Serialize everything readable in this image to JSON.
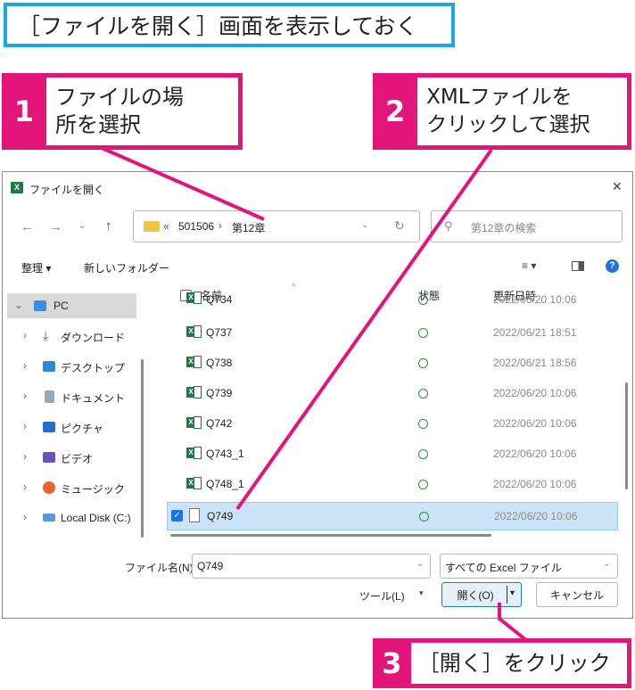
{
  "caption": "［ファイルを開く］画面を表示しておく",
  "callouts": [
    {
      "num": "1",
      "line1": "ファイルの場",
      "line2": "所を選択"
    },
    {
      "num": "2",
      "line1": "XMLファイルを",
      "line2": "クリックして選択"
    },
    {
      "num": "3",
      "line1": "［開く］をクリック"
    }
  ],
  "colors": {
    "accent": "#e4157a",
    "caption_border": "#1ba7e1",
    "excel_green": "#1d7a44",
    "selection": "#cce4f7"
  },
  "dialog": {
    "title": "ファイルを開く",
    "close_glyph": "✕",
    "breadcrumb": {
      "prefix": "«",
      "segments": [
        "501506",
        "第12章"
      ],
      "separator": "›"
    },
    "search_placeholder": "第12章の検索",
    "toolbar": {
      "organize": "整理 ▾",
      "new_folder": "新しいフォルダー",
      "view_glyph": "≡ ▾"
    },
    "nav": {
      "pc": "PC",
      "items": [
        {
          "label": "ダウンロード",
          "icon": "download-icon"
        },
        {
          "label": "デスクトップ",
          "icon": "desktop-icon"
        },
        {
          "label": "ドキュメント",
          "icon": "documents-icon"
        },
        {
          "label": "ピクチャ",
          "icon": "pictures-icon"
        },
        {
          "label": "ビデオ",
          "icon": "videos-icon"
        },
        {
          "label": "ミュージック",
          "icon": "music-icon"
        },
        {
          "label": "Local Disk (C:)",
          "icon": "local-disk-icon"
        }
      ]
    },
    "columns": {
      "name": "名前",
      "status": "状態",
      "modified": "更新日時"
    },
    "files": [
      {
        "name": "Q734",
        "modified": "2022/06/20 10:06",
        "type": "excel",
        "selected": false,
        "partial": true
      },
      {
        "name": "Q737",
        "modified": "2022/06/21 18:51",
        "type": "excel",
        "selected": false
      },
      {
        "name": "Q738",
        "modified": "2022/06/21 18:56",
        "type": "excel",
        "selected": false
      },
      {
        "name": "Q739",
        "modified": "2022/06/20 10:06",
        "type": "excel",
        "selected": false
      },
      {
        "name": "Q742",
        "modified": "2022/06/20 10:06",
        "type": "excel",
        "selected": false
      },
      {
        "name": "Q743_1",
        "modified": "2022/06/20 10:06",
        "type": "excel",
        "selected": false
      },
      {
        "name": "Q748_1",
        "modified": "2022/06/20 10:06",
        "type": "excel",
        "selected": false
      },
      {
        "name": "Q749",
        "modified": "2022/06/20 10:06",
        "type": "xml",
        "selected": true
      }
    ],
    "filename_label": "ファイル名(N):",
    "filename_value": "Q749",
    "filetype_value": "すべての Excel ファイル",
    "tools_label": "ツール(L)",
    "open_label": "開く(O)",
    "cancel_label": "キャンセル"
  }
}
